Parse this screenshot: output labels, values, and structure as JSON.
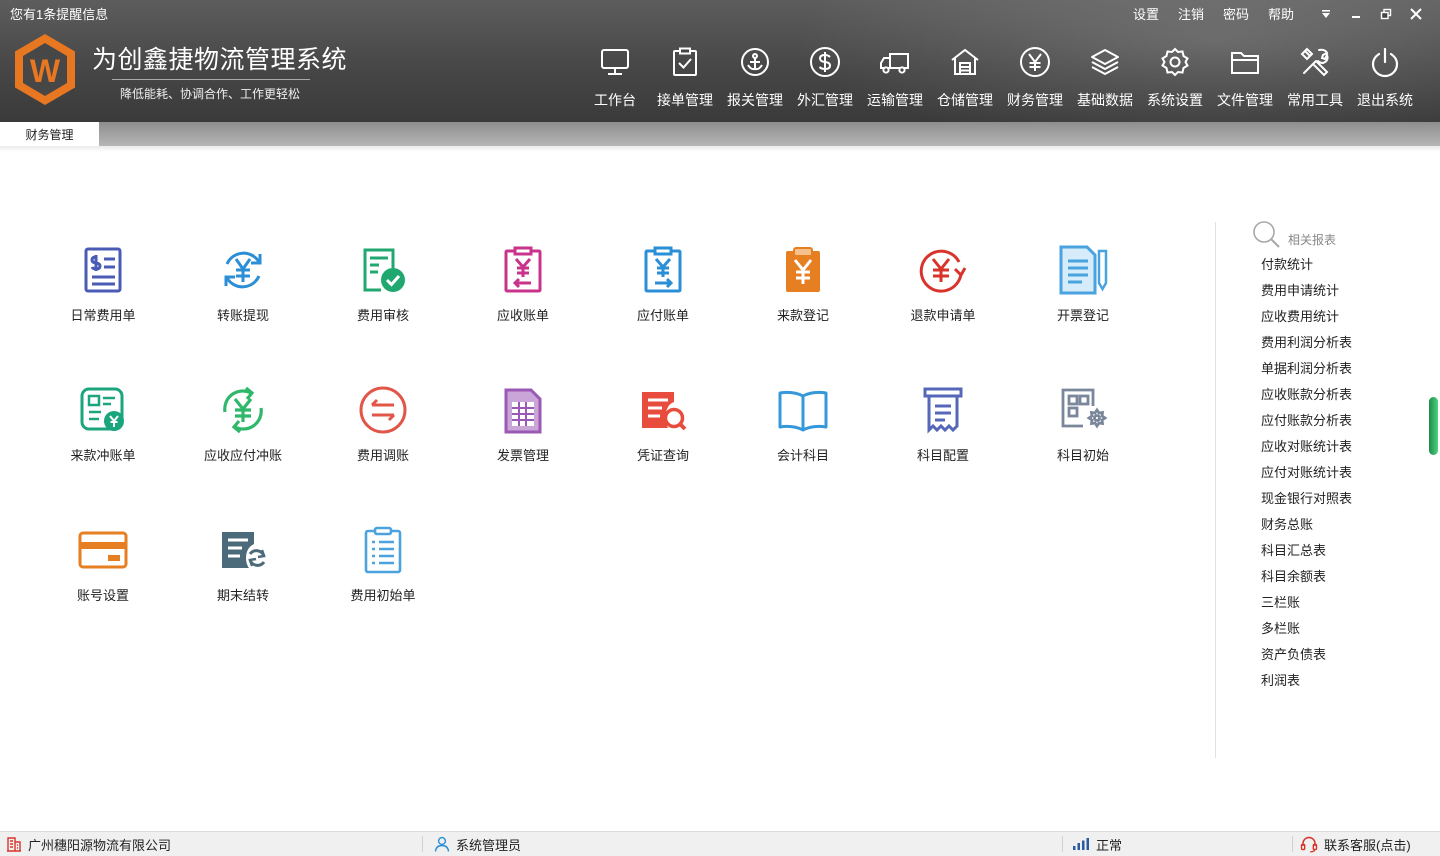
{
  "header": {
    "notification": "您有1条提醒信息",
    "top_links": [
      "设置",
      "注销",
      "密码",
      "帮助"
    ],
    "app_title": "为创鑫捷物流管理系统",
    "app_subtitle": "降低能耗、协调合作、工作更轻松",
    "logo_letter": "W"
  },
  "nav": [
    {
      "label": "工作台",
      "icon": "monitor-icon"
    },
    {
      "label": "接单管理",
      "icon": "clipboard-check-icon"
    },
    {
      "label": "报关管理",
      "icon": "anchor-icon"
    },
    {
      "label": "外汇管理",
      "icon": "dollar-icon"
    },
    {
      "label": "运输管理",
      "icon": "truck-icon"
    },
    {
      "label": "仓储管理",
      "icon": "warehouse-icon"
    },
    {
      "label": "财务管理",
      "icon": "yen-icon"
    },
    {
      "label": "基础数据",
      "icon": "layers-icon"
    },
    {
      "label": "系统设置",
      "icon": "gear-icon"
    },
    {
      "label": "文件管理",
      "icon": "folder-icon"
    },
    {
      "label": "常用工具",
      "icon": "tools-icon"
    },
    {
      "label": "退出系统",
      "icon": "power-icon"
    }
  ],
  "tabs": [
    {
      "label": "财务管理",
      "active": true
    }
  ],
  "functions": [
    {
      "label": "日常费用单",
      "icon": "expense-doc-icon",
      "color": "#4a5bb5"
    },
    {
      "label": "转账提现",
      "icon": "transfer-yen-icon",
      "color": "#2a8fd6"
    },
    {
      "label": "费用审核",
      "icon": "audit-check-icon",
      "color": "#20a870"
    },
    {
      "label": "应收账单",
      "icon": "receivable-bill-icon",
      "color": "#c8348b"
    },
    {
      "label": "应付账单",
      "icon": "payable-bill-icon",
      "color": "#2a8fd6"
    },
    {
      "label": "来款登记",
      "icon": "income-register-icon",
      "color": "#e67e22"
    },
    {
      "label": "退款申请单",
      "icon": "refund-icon",
      "color": "#d9342b"
    },
    {
      "label": "开票登记",
      "icon": "invoice-register-icon",
      "color": "#4aa3df"
    },
    {
      "label": "来款冲账单",
      "icon": "income-offset-icon",
      "color": "#1aa57c"
    },
    {
      "label": "应收应付冲账",
      "icon": "ar-ap-offset-icon",
      "color": "#2fb86b"
    },
    {
      "label": "费用调账",
      "icon": "expense-adjust-icon",
      "color": "#e2564a"
    },
    {
      "label": "发票管理",
      "icon": "invoice-manage-icon",
      "color": "#9b59b6"
    },
    {
      "label": "凭证查询",
      "icon": "voucher-query-icon",
      "color": "#e74c3c"
    },
    {
      "label": "会计科目",
      "icon": "account-book-icon",
      "color": "#3498db"
    },
    {
      "label": "科目配置",
      "icon": "subject-config-icon",
      "color": "#5567b8"
    },
    {
      "label": "科目初始",
      "icon": "subject-init-icon",
      "color": "#7a8699"
    },
    {
      "label": "账号设置",
      "icon": "bank-card-icon",
      "color": "#e67e22"
    },
    {
      "label": "期末结转",
      "icon": "period-close-icon",
      "color": "#4b6b7a"
    },
    {
      "label": "费用初始单",
      "icon": "expense-init-icon",
      "color": "#4aa3df"
    }
  ],
  "reports": {
    "title": "相关报表",
    "items": [
      "付款统计",
      "费用申请统计",
      "应收费用统计",
      "费用利润分析表",
      "单据利润分析表",
      "应收账款分析表",
      "应付账款分析表",
      "应收对账统计表",
      "应付对账统计表",
      "现金银行对照表",
      "财务总账",
      "科目汇总表",
      "科目余额表",
      "三栏账",
      "多栏账",
      "资产负债表",
      "利润表"
    ]
  },
  "statusbar": {
    "company": "广州穗阳源物流有限公司",
    "user": "系统管理员",
    "status": "正常",
    "support": "联系客服(点击)"
  },
  "colors": {
    "header_bg": "#474747",
    "logo_orange": "#e87722",
    "tab_bar": "#a0a0a0",
    "scroll_accent": "#2ecc71"
  }
}
